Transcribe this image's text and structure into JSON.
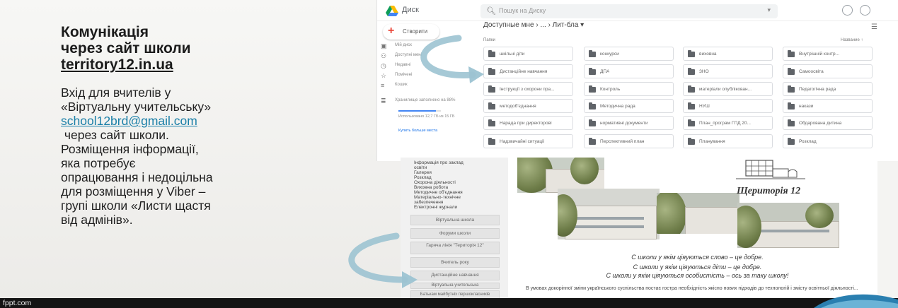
{
  "slide": {
    "title_line1": "Комунікація",
    "title_line2": "через сайт школи",
    "title_link": "territory12.in.ua",
    "body_line1": "Вхід для вчителів у",
    "body_line2": "«Віртуальну учительську»",
    "body_email": "school12brd@gmail.com",
    "body_line4": " через сайт школи.",
    "body_line5": "Розміщення інформації,",
    "body_line6": "яка потребує",
    "body_line7": "опрацювання і недоцільна",
    "body_line8": "для розміщення у Viber –",
    "body_line9": "групі школи «Листи щастя",
    "body_line10": "від адмінів»."
  },
  "drive": {
    "app_name": "Диск",
    "search_placeholder": "Пошук на Диску",
    "create_label": "Створити",
    "breadcrumb": "Доступные мне › ... › Лит-бла ▾",
    "folders_label": "Папки",
    "sort_label": "Название ↑",
    "side_items": [
      "Мій диск",
      "Доступні мені",
      "Недавні",
      "Помічені",
      "Кошик"
    ],
    "storage_label": "Хранилище заполнено на 88%",
    "storage_used_label": "Использовано 12,7 ГБ из 15 ГБ",
    "storage_fraction": 0.88,
    "buy_storage_label": "Купить больше места",
    "folders": [
      "шкільні діти",
      "конкурси",
      "виховна",
      "Внутрішній контр...",
      "Дистанційне навчання",
      "ДПА",
      "ЗНО",
      "Самоосвіта",
      "Інструкції з охорони пра...",
      "Контроль",
      "матеріали опублікован...",
      "Педагогічна рада",
      "методоб'єднання",
      "Методична рада",
      "НУШ",
      "накази",
      "Нарада при директорові",
      "нормативні документи",
      "План_програм ГПД 20...",
      "Обдарована дитина",
      "Надзвичайні ситуації",
      "Перспективний план",
      "Планування",
      "Розклад"
    ]
  },
  "site": {
    "menu_text": [
      "Інформація про заклад",
      "освіти",
      "Галерея",
      "Розклад",
      "Охорона діяльності",
      "Виховна робота",
      "Методичне об'єднання",
      "Матеріально-технічне",
      "забезпечення",
      "Електронні журнали"
    ],
    "menu_buttons": [
      "Віртуальна школа",
      "Форуми школи",
      "Гаряча лінія \"Територія 12\"",
      "Вчитель року",
      "Дистанційне навчання",
      "Віртуальна учительська",
      "Батькам майбутніх першокласників"
    ],
    "logo_caption": "Щериторія 12",
    "quote1": "С школи у якім ціяуються слово – це добре.",
    "quote2": "С школи у якім ціяуються діти – це добре.",
    "quote3": "С школи у якім ціяуються особистість – ось за таку школу!",
    "paragraph": "В умовах докорінної зміни українського суспільства постає гостра необхідність якісно нових підходів до технологій і змісту освітньої діяльності..."
  },
  "footer": {
    "brand": "fppt.com"
  },
  "colors": {
    "link": "#1a7fa8",
    "arrow": "#8fb8c8",
    "swoosh": "#2a7fb0"
  }
}
